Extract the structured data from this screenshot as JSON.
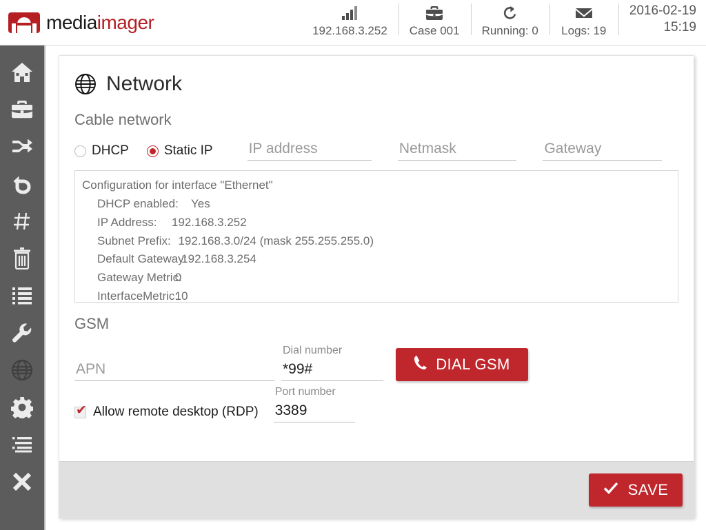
{
  "header": {
    "logo": {
      "part1": "media",
      "part2": "imager",
      "icon": "mediaimager-logo-icon"
    },
    "items": [
      {
        "icon": "signal-bars-icon",
        "label": "192.168.3.252"
      },
      {
        "icon": "briefcase-icon",
        "label": "Case 001"
      },
      {
        "icon": "refresh-icon",
        "label": "Running: 0"
      },
      {
        "icon": "envelope-icon",
        "label": "Logs: 19"
      }
    ],
    "date": "2016-02-19",
    "time": "15:19"
  },
  "sidebar": {
    "items": [
      {
        "name": "home",
        "icon": "home-icon"
      },
      {
        "name": "case",
        "icon": "briefcase-icon"
      },
      {
        "name": "transfer",
        "icon": "shuffle-icon"
      },
      {
        "name": "undo",
        "icon": "undo-arrow-icon"
      },
      {
        "name": "hash",
        "icon": "hash-icon"
      },
      {
        "name": "wipe",
        "icon": "trash-icon"
      },
      {
        "name": "list",
        "icon": "list-icon"
      },
      {
        "name": "tools",
        "icon": "wrench-icon"
      },
      {
        "name": "network",
        "icon": "globe-icon"
      },
      {
        "name": "settings",
        "icon": "gear-icon"
      },
      {
        "name": "log",
        "icon": "indented-list-icon"
      },
      {
        "name": "close",
        "icon": "x-icon"
      }
    ],
    "active": "network"
  },
  "page": {
    "title": "Network",
    "title_icon": "globe-icon",
    "cable_section_label": "Cable network",
    "radios": [
      {
        "label": "DHCP",
        "selected": false
      },
      {
        "label": "Static IP",
        "selected": true
      }
    ],
    "fields": {
      "ip_address": {
        "value": "",
        "placeholder": "IP address"
      },
      "netmask": {
        "value": "",
        "placeholder": "Netmask"
      },
      "gateway": {
        "value": "",
        "placeholder": "Gateway"
      }
    },
    "config": {
      "title": "Configuration for interface \"Ethernet\"",
      "rows": [
        {
          "key": "DHCP enabled:",
          "value": "      Yes"
        },
        {
          "key": "IP Address:",
          "value": "192.168.3.252"
        },
        {
          "key": "Subnet Prefix:",
          "value": "  192.168.3.0/24 (mask 255.255.255.0)"
        },
        {
          "key": "Default Gateway:",
          "value": "   192.168.3.254"
        },
        {
          "key": "Gateway Metric:",
          "value": " 0"
        },
        {
          "key": "InterfaceMetric:",
          "value": " 10"
        }
      ]
    },
    "gsm_section_label": "GSM",
    "gsm": {
      "apn": {
        "value": "",
        "placeholder": "APN",
        "label": ""
      },
      "dial_number": {
        "value": "*99#",
        "placeholder": "",
        "label": "Dial number"
      },
      "dial_button": {
        "label": "DIAL GSM",
        "icon": "phone-icon"
      }
    },
    "rdp": {
      "checkbox_label": "Allow remote desktop (RDP)",
      "checked": true,
      "port": {
        "value": "3389",
        "placeholder": "",
        "label": "Port number"
      }
    },
    "save_button": {
      "label": "SAVE",
      "icon": "check-icon"
    }
  },
  "colors": {
    "brand_red": "#c0272d",
    "logo_red": "#b51f24",
    "sidebar_bg": "#5c5c5c",
    "footer_bg": "#e0e0e0"
  }
}
